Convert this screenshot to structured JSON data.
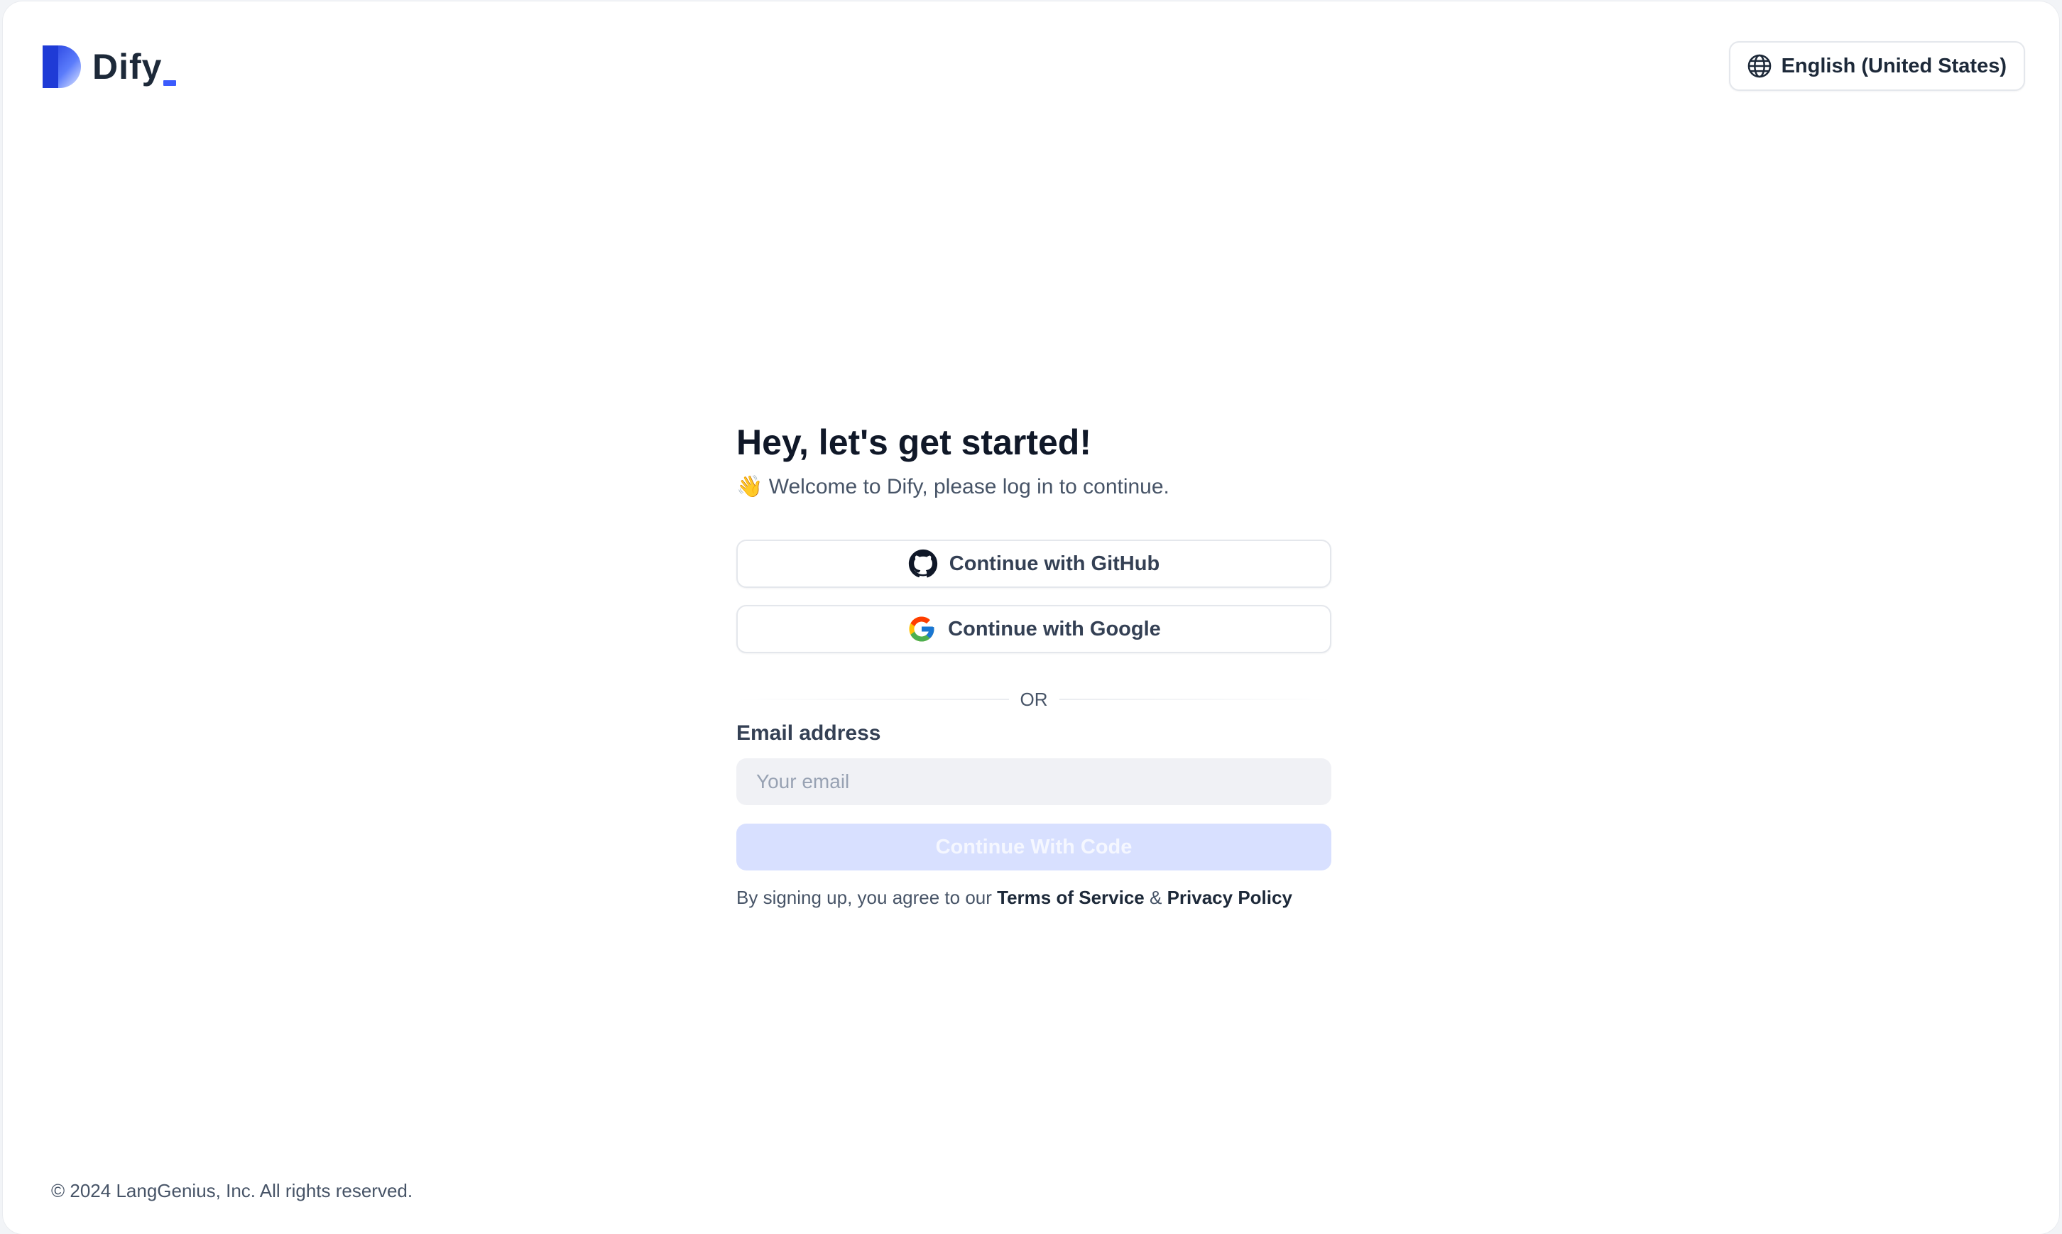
{
  "header": {
    "logo_text": "Dify",
    "language_label": "English (United States)",
    "language_icon": "globe-icon"
  },
  "main": {
    "heading": "Hey, let's get started!",
    "subheading_emoji": "👋",
    "subheading": "Welcome to Dify, please log in to continue.",
    "github_button": {
      "label": "Continue with GitHub",
      "icon": "github-icon"
    },
    "google_button": {
      "label": "Continue with Google",
      "icon": "google-icon"
    },
    "divider_text": "OR",
    "email_label": "Email address",
    "email_placeholder": "Your email",
    "email_value": "",
    "submit_label": "Continue With Code",
    "terms_prefix": "By signing up, you agree to our",
    "terms_link": "Terms of Service",
    "terms_separator": "&",
    "privacy_link": "Privacy Policy"
  },
  "footer": {
    "copyright": "© 2024 LangGenius, Inc. All rights reserved."
  },
  "colors": {
    "brand_blue": "#3b5bfd",
    "submit_disabled_bg": "#d8e0ff",
    "text_primary": "#101828",
    "text_secondary": "#475467"
  }
}
